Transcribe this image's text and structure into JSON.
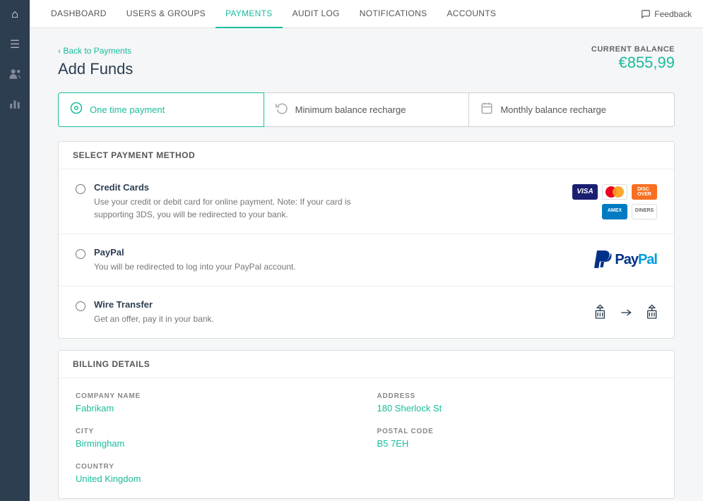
{
  "sidebar": {
    "icons": [
      {
        "name": "home-icon",
        "symbol": "⌂",
        "active": true
      },
      {
        "name": "menu-icon",
        "symbol": "☰",
        "active": false
      },
      {
        "name": "users-icon",
        "symbol": "👥",
        "active": false
      },
      {
        "name": "chart-icon",
        "symbol": "📊",
        "active": false
      }
    ]
  },
  "topnav": {
    "items": [
      {
        "label": "DASHBOARD",
        "active": false
      },
      {
        "label": "USERS & GROUPS",
        "active": false
      },
      {
        "label": "PAYMENTS",
        "active": true
      },
      {
        "label": "AUDIT LOG",
        "active": false
      },
      {
        "label": "NOTIFICATIONS",
        "active": false
      },
      {
        "label": "ACCOUNTS",
        "active": false
      }
    ],
    "feedback_label": "Feedback"
  },
  "page": {
    "back_label": "‹ Back to Payments",
    "title": "Add Funds",
    "balance_label": "Current Balance",
    "balance_value": "€855,99"
  },
  "payment_tabs": [
    {
      "label": "One time payment",
      "icon": "⊙",
      "active": true
    },
    {
      "label": "Minimum balance recharge",
      "icon": "↻",
      "active": false
    },
    {
      "label": "Monthly balance recharge",
      "icon": "📅",
      "active": false
    }
  ],
  "payment_methods": {
    "section_title": "Select Payment Method",
    "methods": [
      {
        "name": "Credit Cards",
        "description": "Use your credit or debit card for online payment. Note: If your card is supporting 3DS, you will be redirected to your bank."
      },
      {
        "name": "PayPal",
        "description": "You will be redirected to log into your PayPal account."
      },
      {
        "name": "Wire Transfer",
        "description": "Get an offer, pay it in your bank."
      }
    ]
  },
  "billing": {
    "section_title": "Billing Details",
    "fields": [
      {
        "label": "COMPANY NAME",
        "value": "Fabrikam"
      },
      {
        "label": "ADDRESS",
        "value": "180 Sherlock St"
      },
      {
        "label": "CITY",
        "value": "Birmingham"
      },
      {
        "label": "POSTAL CODE",
        "value": "B5 7EH"
      },
      {
        "label": "COUNTRY",
        "value": "United Kingdom"
      }
    ]
  }
}
